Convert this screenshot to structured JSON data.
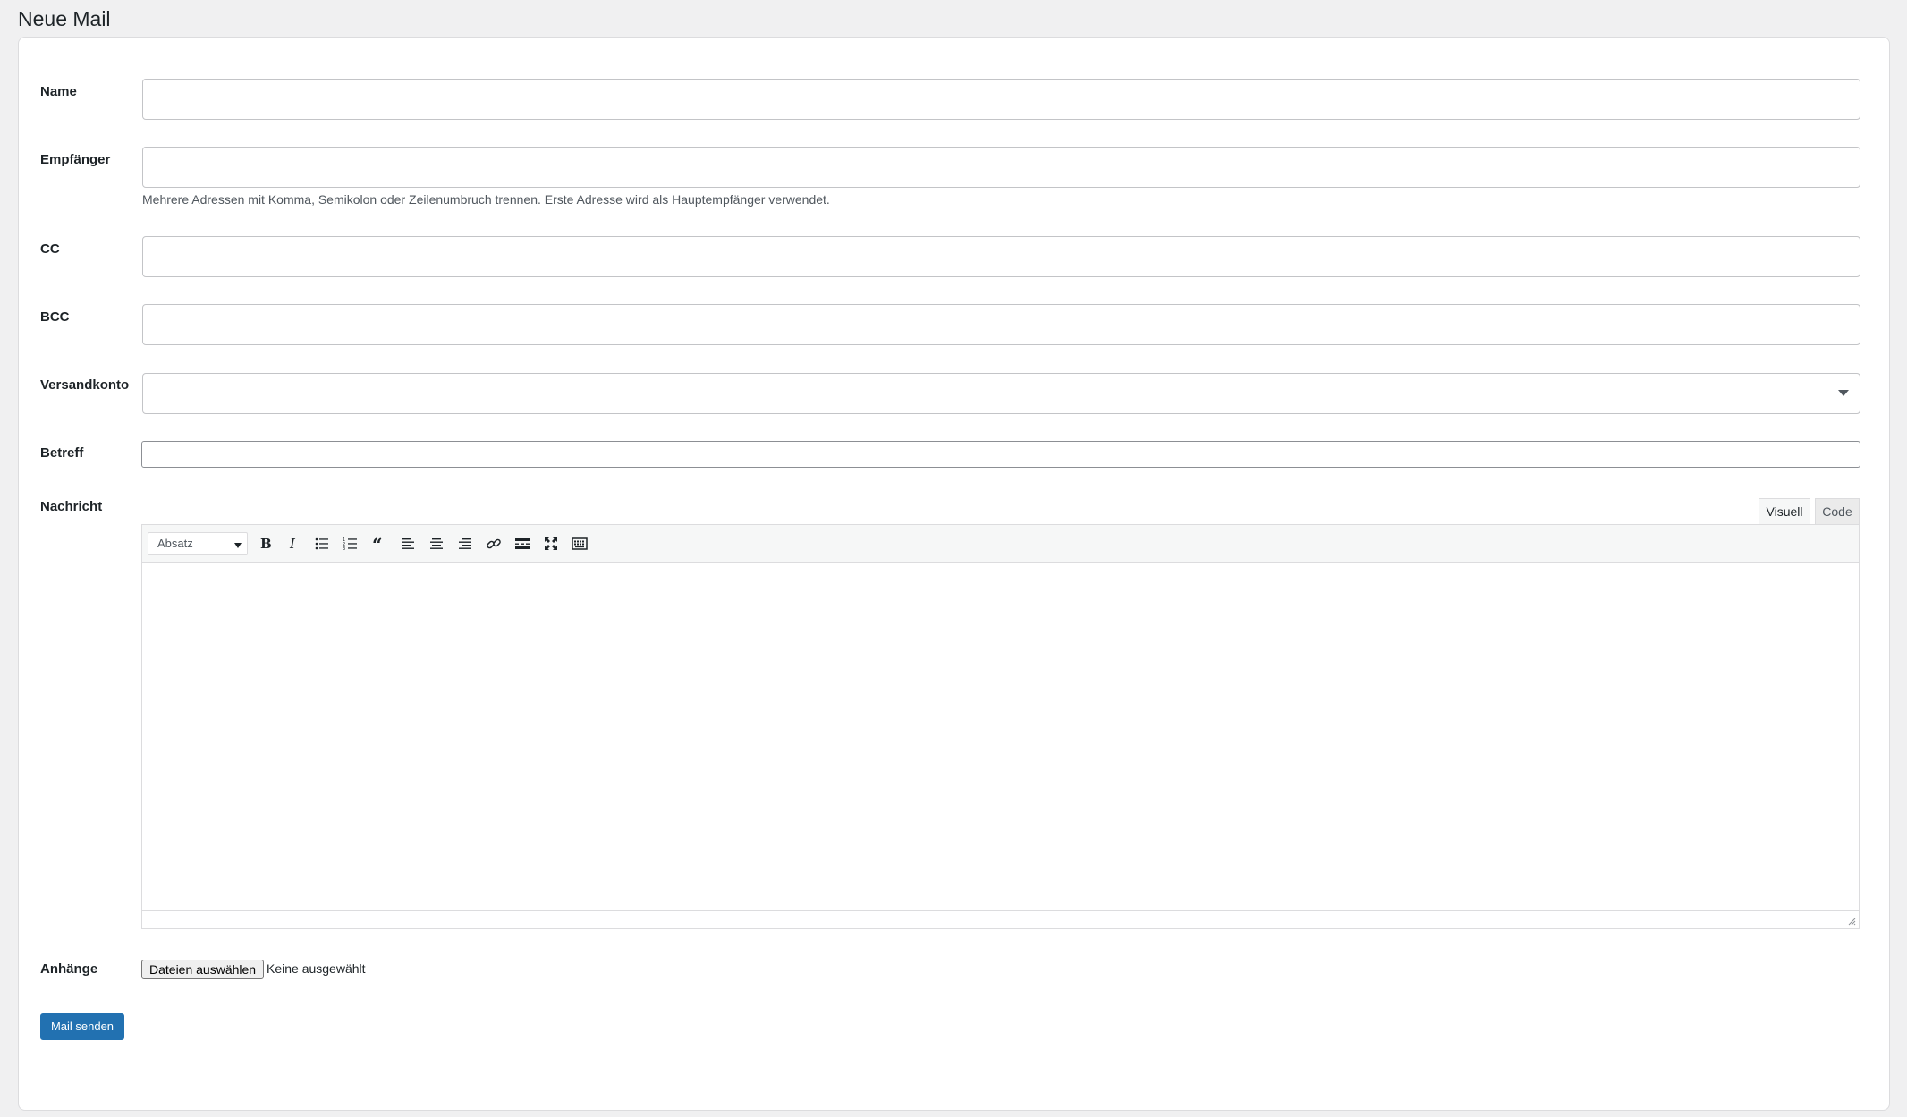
{
  "page": {
    "title": "Neue Mail"
  },
  "form": {
    "name_label": "Name",
    "name_value": "",
    "recipient_label": "Empfänger",
    "recipient_value": "",
    "recipient_help": "Mehrere Adressen mit Komma, Semikolon oder Zeilenumbruch trennen. Erste Adresse wird als Hauptempfänger verwendet.",
    "cc_label": "CC",
    "cc_value": "",
    "bcc_label": "BCC",
    "bcc_value": "",
    "account_label": "Versandkonto",
    "account_value": "",
    "subject_label": "Betreff",
    "subject_value": "",
    "message_label": "Nachricht",
    "attachments_label": "Anhänge"
  },
  "editor": {
    "tabs": [
      "Visuell",
      "Code"
    ],
    "active_tab": "Visuell",
    "format_value": "Absatz",
    "toolbar_icons": [
      "bold-icon",
      "italic-icon",
      "bullet-list-icon",
      "numbered-list-icon",
      "blockquote-icon",
      "align-left-icon",
      "align-center-icon",
      "align-right-icon",
      "link-icon",
      "read-more-icon",
      "fullscreen-icon",
      "toolbar-toggle-icon"
    ]
  },
  "attachments": {
    "button_label": "Dateien auswählen",
    "status": "Keine ausgewählt"
  },
  "actions": {
    "send_label": "Mail senden"
  },
  "colors": {
    "primary": "#2271b1",
    "background": "#f0f0f1",
    "card": "#ffffff"
  }
}
